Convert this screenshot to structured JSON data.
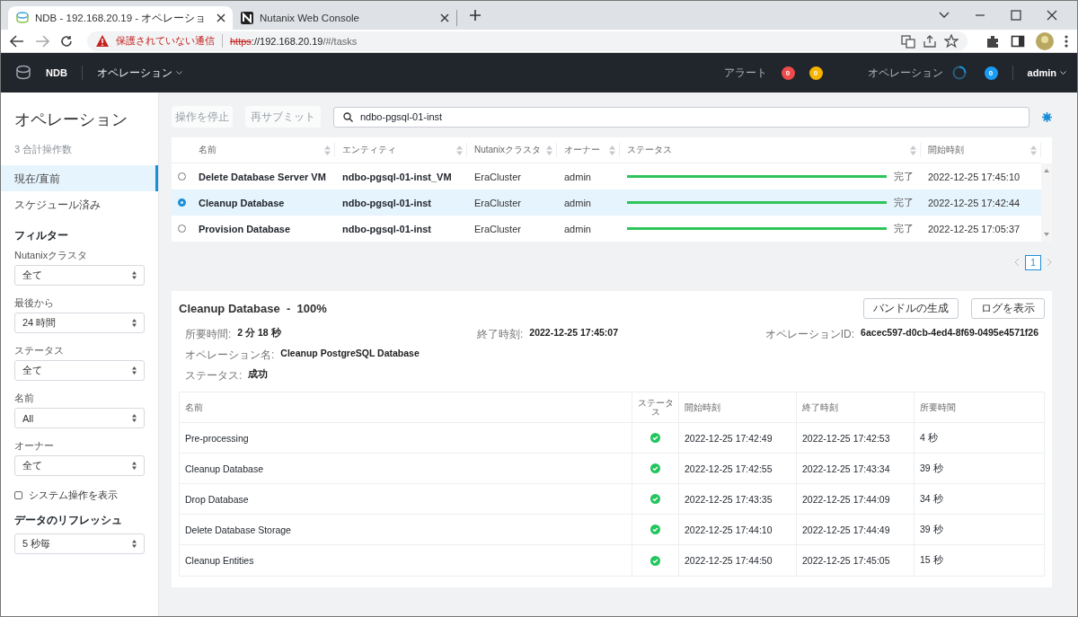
{
  "browser": {
    "tabs": [
      {
        "title": "NDB - 192.168.20.19 - オペレーショ",
        "selected": true,
        "kind": "ndb"
      },
      {
        "title": "Nutanix Web Console",
        "selected": false,
        "kind": "nutanix"
      }
    ],
    "address": {
      "warning": "保護されていない通信",
      "scheme": "https",
      "host": "://192.168.20.19",
      "path": "/#/tasks"
    }
  },
  "header": {
    "product": "NDB",
    "menu": "オペレーション",
    "alerts_label": "アラート",
    "alert_counts": [
      {
        "count": "0",
        "color": "#ef4b4b"
      },
      {
        "count": "0",
        "color": "#f5b400"
      }
    ],
    "operations_label": "オペレーション",
    "operations_count": "0",
    "user": "admin"
  },
  "sidebar": {
    "title": "オペレーション",
    "count_text": "3 合計操作数",
    "nav": [
      {
        "label": "現在/直前",
        "selected": true
      },
      {
        "label": "スケジュール済み",
        "selected": false
      }
    ],
    "filter_title": "フィルター",
    "filters": [
      {
        "label": "Nutanixクラスタ",
        "value": "全て"
      },
      {
        "label": "最後から",
        "value": "24 時間"
      },
      {
        "label": "ステータス",
        "value": "全て"
      },
      {
        "label": "名前",
        "value": "All"
      },
      {
        "label": "オーナー",
        "value": "全て"
      }
    ],
    "system_ops": {
      "label": "システム操作を表示",
      "checked": false
    },
    "refresh": {
      "label": "データのリフレッシュ",
      "value": "5 秒毎"
    }
  },
  "toolbar": {
    "buttons": [
      {
        "label": "操作を停止",
        "disabled": true
      },
      {
        "label": "再サブミット",
        "disabled": true
      }
    ],
    "search": "ndbo-pgsql-01-inst"
  },
  "operations": {
    "columns": [
      "名前",
      "エンティティ",
      "Nutanixクラスタ",
      "オーナー",
      "ステータス",
      "開始時刻"
    ],
    "rows": [
      {
        "selected": false,
        "name": "Delete Database Server VM",
        "entity": "ndbo-pgsql-01-inst_VM",
        "cluster": "EraCluster",
        "owner": "admin",
        "level": 1,
        "status": "完了",
        "start": "2022-12-25 17:45:10"
      },
      {
        "selected": true,
        "name": "Cleanup Database",
        "entity": "ndbo-pgsql-01-inst",
        "cluster": "EraCluster",
        "owner": "admin",
        "level": 1,
        "status": "完了",
        "start": "2022-12-25 17:42:44"
      },
      {
        "selected": false,
        "name": "Provision Database",
        "entity": "ndbo-pgsql-01-inst",
        "cluster": "EraCluster",
        "owner": "admin",
        "level": 1,
        "status": "完了",
        "start": "2022-12-25 17:05:37"
      }
    ],
    "page": "1"
  },
  "detail": {
    "title": "Cleanup Database  -  100%",
    "buttons": [
      "バンドルの生成",
      "ログを表示"
    ],
    "fields": [
      {
        "label": "所要時間:",
        "value": "2 分 18 秒"
      },
      {
        "label": "終了時刻:",
        "value": "2022-12-25 17:45:07"
      },
      {
        "label": "オペレーションID:",
        "value": "6acec597-d0cb-4ed4-8f69-0495e4571f26"
      },
      {
        "label": "オペレーション名:",
        "value": "Cleanup PostgreSQL Database"
      },
      {
        "label": "ステータス:",
        "value": "成功"
      }
    ],
    "columns": [
      "名前",
      "ステータス",
      "開始時刻",
      "終了時刻",
      "所要時間"
    ],
    "steps": [
      {
        "name": "Pre-processing",
        "done": true,
        "start": "2022-12-25 17:42:49",
        "end": "2022-12-25 17:42:53",
        "duration": "4 秒"
      },
      {
        "name": "Cleanup Database",
        "done": true,
        "start": "2022-12-25 17:42:55",
        "end": "2022-12-25 17:43:34",
        "duration": "39 秒"
      },
      {
        "name": "Drop Database",
        "done": true,
        "start": "2022-12-25 17:43:35",
        "end": "2022-12-25 17:44:09",
        "duration": "34 秒"
      },
      {
        "name": "Delete Database Storage",
        "done": true,
        "start": "2022-12-25 17:44:10",
        "end": "2022-12-25 17:44:49",
        "duration": "39 秒"
      },
      {
        "name": "Cleanup Entities",
        "done": true,
        "start": "2022-12-25 17:44:50",
        "end": "2022-12-25 17:45:05",
        "duration": "15 秒"
      }
    ]
  }
}
